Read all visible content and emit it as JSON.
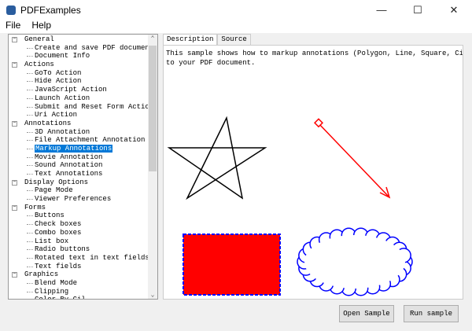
{
  "window": {
    "title": "PDFExamples",
    "icon": "gear-app-icon"
  },
  "menu": [
    "File",
    "Help"
  ],
  "tree": [
    {
      "label": "General",
      "children": [
        "Create and save PDF document",
        "Document Info"
      ]
    },
    {
      "label": "Actions",
      "children": [
        "GoTo Action",
        "Hide Action",
        "JavaScript Action",
        "Launch Action",
        "Submit and Reset Form Actions",
        "Uri Action"
      ]
    },
    {
      "label": "Annotations",
      "children": [
        "3D Annotation",
        "File Attachment Annotation",
        "Markup Annotations",
        "Movie Annotation",
        "Sound Annotation",
        "Text Annotations"
      ]
    },
    {
      "label": "Display Options",
      "children": [
        "Page Mode",
        "Viewer Preferences"
      ]
    },
    {
      "label": "Forms",
      "children": [
        "Buttons",
        "Check boxes",
        "Combo boxes",
        "List box",
        "Radio buttons",
        "Rotated text in text fields",
        "Text fields"
      ]
    },
    {
      "label": "Graphics",
      "children": [
        "Blend Mode",
        "Clipping",
        "Color By Cil"
      ]
    }
  ],
  "selected": "Markup Annotations",
  "tabs": [
    "Description",
    "Source"
  ],
  "active_tab": "Description",
  "description": "This sample shows how to markup annotations (Polygon, Line, Square, Circle etc.)\nto your PDF document.",
  "colors": {
    "line": "#ff0000",
    "square_fill": "#ff0000",
    "square_border": "#0000ff",
    "cloud": "#0000ff",
    "selection": "#0078d7"
  },
  "buttons": {
    "open": "Open Sample",
    "run": "Run sample"
  }
}
